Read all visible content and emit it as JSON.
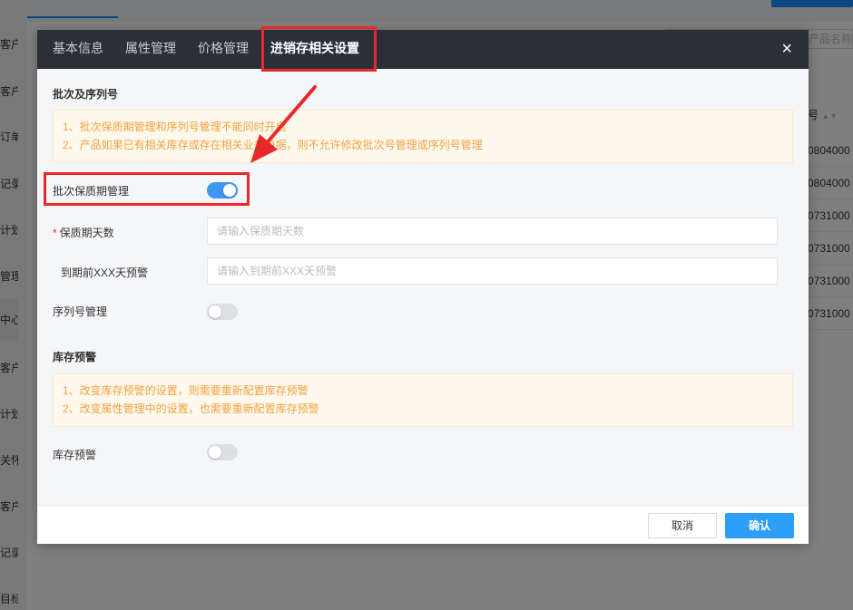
{
  "background": {
    "sidebar_items": [
      "客户",
      "客户",
      "订单",
      "记录",
      "计划",
      "管理",
      "中心",
      "客户",
      "计划",
      "关怀",
      "客户",
      "记录",
      "目标"
    ],
    "search_placeholder": "入产品名称",
    "table_header": "号",
    "rows": [
      "0804000",
      "0804000",
      "0731000",
      "0731000",
      "0731000",
      "0731000"
    ]
  },
  "modal": {
    "tabs": [
      "基本信息",
      "属性管理",
      "价格管理",
      "进销存相关设置"
    ],
    "active_tab": 3,
    "close_label": "×",
    "batch_section": {
      "title": "批次及序列号",
      "notice_lines": [
        "1、批次保质期管理和序列号管理不能同时开启",
        "2、产品如果已有相关库存或存在相关业务单据，则不允许修改批次号管理或序列号管理"
      ],
      "batch_toggle": {
        "label": "批次保质期管理",
        "on": true
      },
      "shelf_life": {
        "required_mark": "*",
        "label": "保质期天数",
        "placeholder": "请输入保质期天数",
        "value": ""
      },
      "expiry_warning": {
        "label": "到期前XXX天预警",
        "placeholder": "请输入到期前XXX天预警",
        "value": ""
      },
      "serial_toggle": {
        "label": "序列号管理",
        "on": false
      }
    },
    "stock_section": {
      "title": "库存预警",
      "notice_lines": [
        "1、改变库存预警的设置，则需要重新配置库存预警",
        "2、改变属性管理中的设置，也需要重新配置库存预警"
      ],
      "stock_toggle": {
        "label": "库存预警",
        "on": false
      }
    },
    "footer": {
      "cancel_label": "取消",
      "ok_label": "确认"
    }
  },
  "colors": {
    "header_bg": "#2b2f3a",
    "toggle_on": "#3e97f0",
    "ok_button": "#2d9ef8",
    "notice_text": "#f0a240",
    "annotation": "#e8282b"
  }
}
